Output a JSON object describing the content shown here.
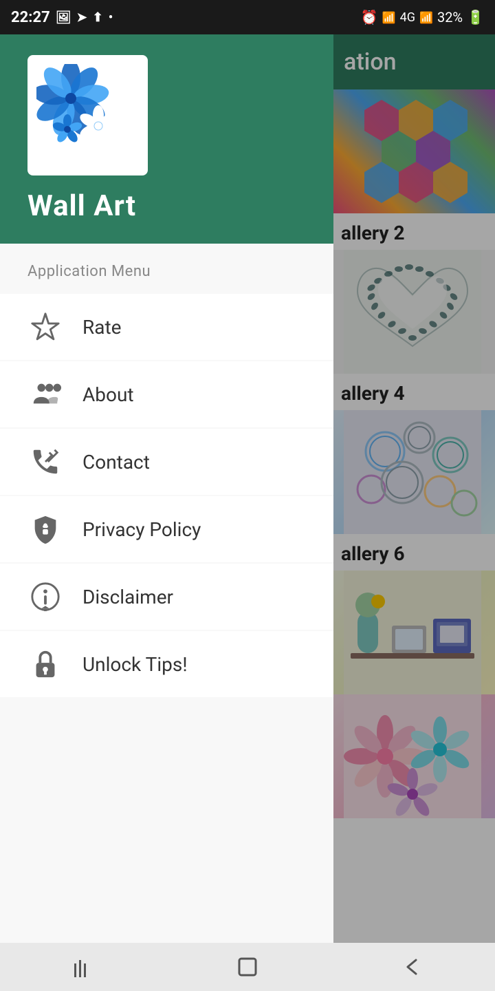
{
  "statusBar": {
    "time": "22:27",
    "batteryPercent": "32%"
  },
  "bgHeader": {
    "titlePartial": "ation"
  },
  "gallery": {
    "items": [
      {
        "label": "allery 2"
      },
      {
        "label": ""
      },
      {
        "label": "allery 4"
      },
      {
        "label": ""
      },
      {
        "label": "allery 6"
      },
      {
        "label": ""
      }
    ]
  },
  "drawer": {
    "appName": "Wall Art",
    "menuSectionLabel": "Application Menu",
    "menuItems": [
      {
        "id": "rate",
        "label": "Rate",
        "icon": "star-icon"
      },
      {
        "id": "about",
        "label": "About",
        "icon": "people-icon"
      },
      {
        "id": "contact",
        "label": "Contact",
        "icon": "phone-icon"
      },
      {
        "id": "privacy",
        "label": "Privacy Policy",
        "icon": "shield-icon"
      },
      {
        "id": "disclaimer",
        "label": "Disclaimer",
        "icon": "info-icon"
      },
      {
        "id": "unlock",
        "label": "Unlock Tips!",
        "icon": "lock-icon"
      }
    ]
  },
  "navBar": {
    "recentLabel": "Recent apps",
    "homeLabel": "Home",
    "backLabel": "Back"
  }
}
